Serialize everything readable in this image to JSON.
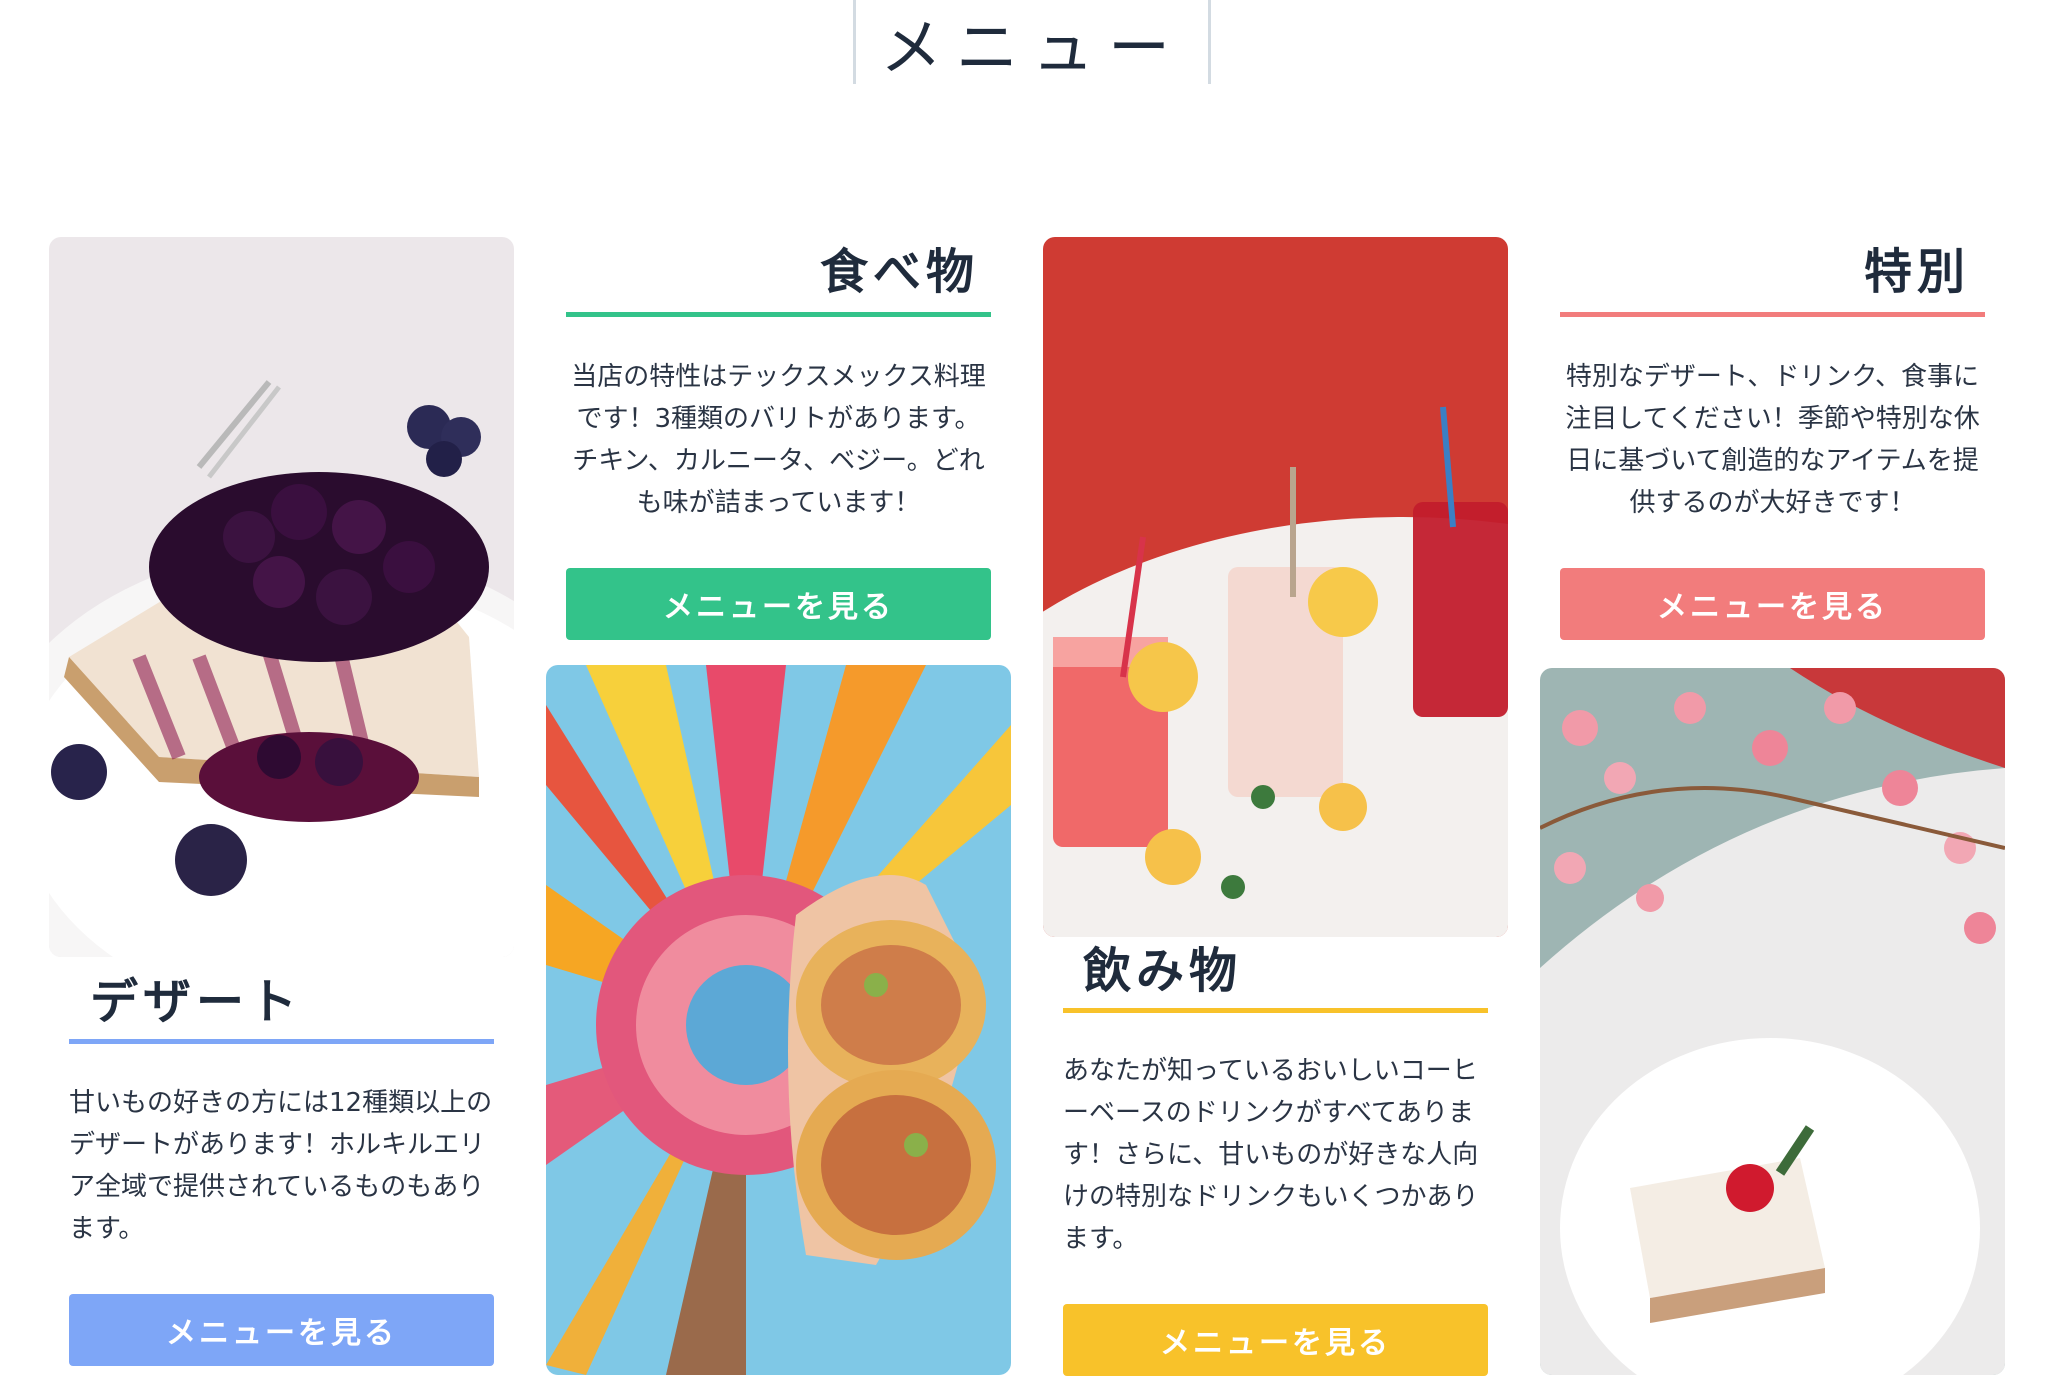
{
  "page": {
    "title": "メニュー"
  },
  "colors": {
    "dessert": "#7ea6f7",
    "food": "#33c38a",
    "drinks": "#f8c22a",
    "special": "#f27c7c"
  },
  "sections": {
    "dessert": {
      "heading": "デザート",
      "description": "甘いもの好きの方には12種類以上のデザートがあります！ホルキルエリア全域で提供されているものもあります。",
      "button_label": "メニューを見る",
      "photo": "blueberry-cheesecake-photo"
    },
    "food": {
      "heading": "食べ物",
      "description": "当店の特性はテックスメックス料理です！3種類のバリトがあります。チキン、カルニータ、ベジー。どれも味が詰まっています！",
      "button_label": "メニューを見る",
      "photo": "burrito-photo"
    },
    "drinks": {
      "heading": "飲み物",
      "description": "あなたが知っているおいしいコーヒーベースのドリンクがすべてあります！さらに、甘いものが好きな人向けの特別なドリンクもいくつかあります。",
      "button_label": "メニューを見る",
      "photo": "lemonade-drinks-photo"
    },
    "special": {
      "heading": "特別",
      "description": "特別なデザート、ドリンク、食事に注目してください！季節や特別な休日に基づいて創造的なアイテムを提供するのが大好きです！",
      "button_label": "メニューを見る",
      "photo": "cherry-blossom-cake-photo"
    }
  }
}
